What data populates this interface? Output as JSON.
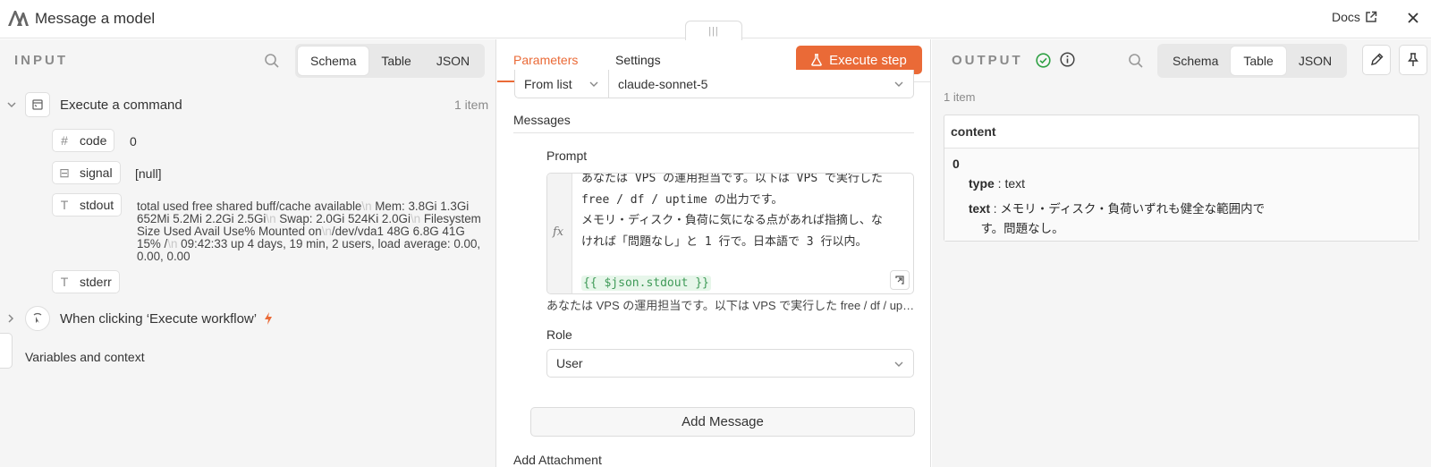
{
  "header": {
    "title": "Message a model",
    "docs_label": "Docs"
  },
  "drag_handle": "|||",
  "input": {
    "label": "INPUT",
    "tabs": [
      "Schema",
      "Table",
      "JSON"
    ],
    "active_tab": "Schema",
    "nodes": [
      {
        "name": "Execute a command",
        "count": "1 item",
        "fields": [
          {
            "type_icon": "#",
            "name": "code",
            "value": "0"
          },
          {
            "type_icon": "⊟",
            "name": "signal",
            "value": "[null]"
          },
          {
            "type_icon": "T",
            "name": "stdout",
            "value_parts": [
              "total used free shared buff/cache available",
              "\\n",
              "Mem: 3.8Gi 1.3Gi 652Mi 5.2Mi 2.2Gi 2.5Gi",
              "\\n",
              "Swap: 2.0Gi 524Ki 2.0Gi",
              "\\n",
              "Filesystem Size Used Avail Use% Mounted on",
              "\\n",
              "/dev/vda1 48G 6.8G 41G 15% /",
              "\\n",
              " 09:42:33 up 4 days, 19 min, 2 users, load average: 0.00, 0.00, 0.00"
            ]
          },
          {
            "type_icon": "T",
            "name": "stderr",
            "value": ""
          }
        ]
      },
      {
        "name": "When clicking ‘Execute workflow’"
      }
    ],
    "variables_label": "Variables and context"
  },
  "params": {
    "tabs": [
      "Parameters",
      "Settings"
    ],
    "execute_label": "Execute step",
    "model_source": "From list",
    "model": "claude-sonnet-5",
    "messages_label": "Messages",
    "prompt_label": "Prompt",
    "prompt_lines": [
      "あなたは VPS の運用担当です。以下は VPS で実行した",
      "free / df / uptime の出力です。",
      "メモリ・ディスク・負荷に気になる点があれば指摘し、な",
      "ければ「問題なし」と 1 行で。日本語で 3 行以内。",
      ""
    ],
    "prompt_expression": "{{ $json.stdout }}",
    "preview": "あなたは VPS の運用担当です。以下は VPS で実行した free / df / uptime の出力です。",
    "role_label": "Role",
    "role_value": "User",
    "add_message": "Add Message",
    "add_attachment": "Add Attachment"
  },
  "output": {
    "label": "OUTPUT",
    "tabs": [
      "Schema",
      "Table",
      "JSON"
    ],
    "active_tab": "Table",
    "count": "1 item",
    "column": "content",
    "index": "0",
    "rows": [
      {
        "key": "type",
        "value": "text"
      },
      {
        "key": "text",
        "value": "メモリ・ディスク・負荷いずれも健全な範囲内で\n　す。問題なし。"
      }
    ]
  },
  "colors": {
    "accent": "#ea6a37",
    "success": "#2ea043",
    "expression": "#3e9a57"
  }
}
